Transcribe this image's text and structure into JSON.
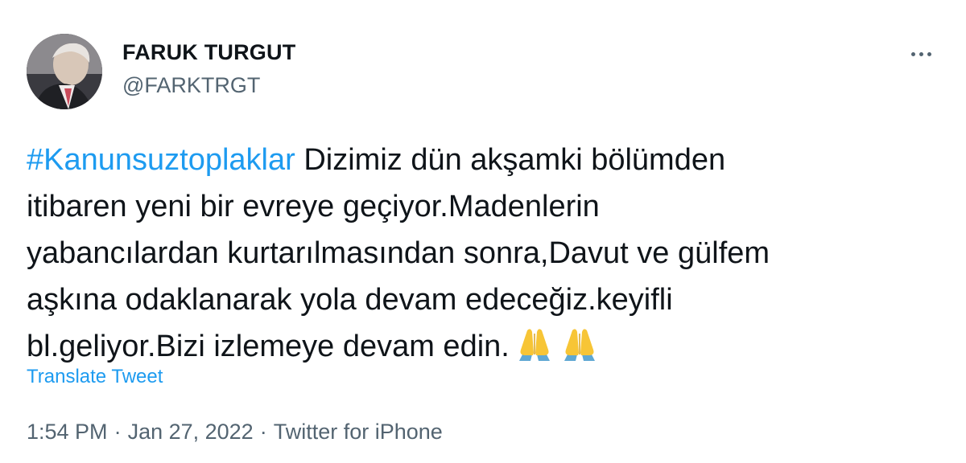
{
  "user": {
    "name": "FARUK TURGUT",
    "handle": "@FARKTRGT"
  },
  "tweet": {
    "hashtag": "#Kanunsuztoplaklar",
    "line1_rest": " Dizimiz dün akşamki bölümden",
    "line2": "itibaren yeni bir evreye geçiyor.Madenlerin",
    "line3": "yabancılardan kurtarılmasından sonra,Davut ve gülfem",
    "line4": "aşkına odaklanarak yola devam edeceğiz.keyifli",
    "line5": "bl.geliyor.Bizi izlemeye devam edin.",
    "emoji": [
      "folded-hands-icon",
      "folded-hands-icon"
    ]
  },
  "translate_label": "Translate Tweet",
  "meta": {
    "time": "1:54 PM",
    "date": "Jan 27, 2022",
    "separator": "·",
    "source": "Twitter for iPhone"
  },
  "colors": {
    "link": "#1d9bf0",
    "secondary_text": "#536471",
    "primary_text": "#0f1419",
    "emoji_skin": "#f7c536",
    "emoji_sleeve": "#5fa8d3"
  }
}
